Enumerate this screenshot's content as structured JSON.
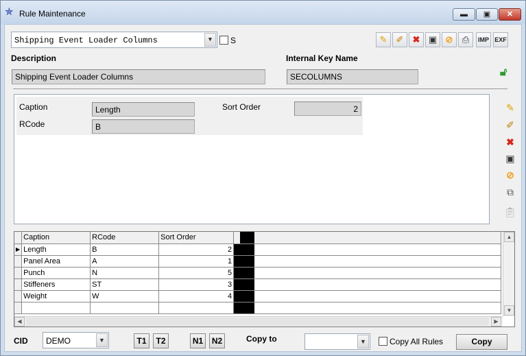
{
  "window": {
    "title": "Rule Maintenance",
    "minimize_glyph": "▬",
    "maximize_glyph": "▣",
    "close_glyph": "✕"
  },
  "rule_select": {
    "value": "Shipping Event Loader Columns",
    "s_label": "S"
  },
  "toolbar": {
    "imp_label": "IMP",
    "exp_label": "EXF"
  },
  "description": {
    "label": "Description",
    "value": "Shipping Event Loader Columns"
  },
  "internal_key": {
    "label": "Internal Key Name",
    "value": "SECOLUMNS"
  },
  "detail": {
    "caption_label": "Caption",
    "caption_value": "Length",
    "rcode_label": "RCode",
    "rcode_value": "B",
    "sort_order_label": "Sort Order",
    "sort_order_value": "2"
  },
  "grid": {
    "columns": [
      "Caption",
      "RCode",
      "Sort Order"
    ],
    "rows": [
      {
        "caption": "Length",
        "rcode": "B",
        "sort_order": "2"
      },
      {
        "caption": "Panel Area",
        "rcode": "A",
        "sort_order": "1"
      },
      {
        "caption": "Punch",
        "rcode": "N",
        "sort_order": "5"
      },
      {
        "caption": "Stiffeners",
        "rcode": "ST",
        "sort_order": "3"
      },
      {
        "caption": "Weight",
        "rcode": "W",
        "sort_order": "4"
      }
    ]
  },
  "footer": {
    "cid_label": "CID",
    "cid_value": "DEMO",
    "t1": "T1",
    "t2": "T2",
    "n1": "N1",
    "n2": "N2",
    "copy_to_label": "Copy to",
    "copy_to_value": "",
    "copy_all_rules_label": "Copy All Rules",
    "copy_button": "Copy"
  },
  "colors": {
    "title_icon": "#2233aa",
    "delete": "#d9261c",
    "cancel": "#f0a020",
    "lock": "#2e9b2e"
  }
}
